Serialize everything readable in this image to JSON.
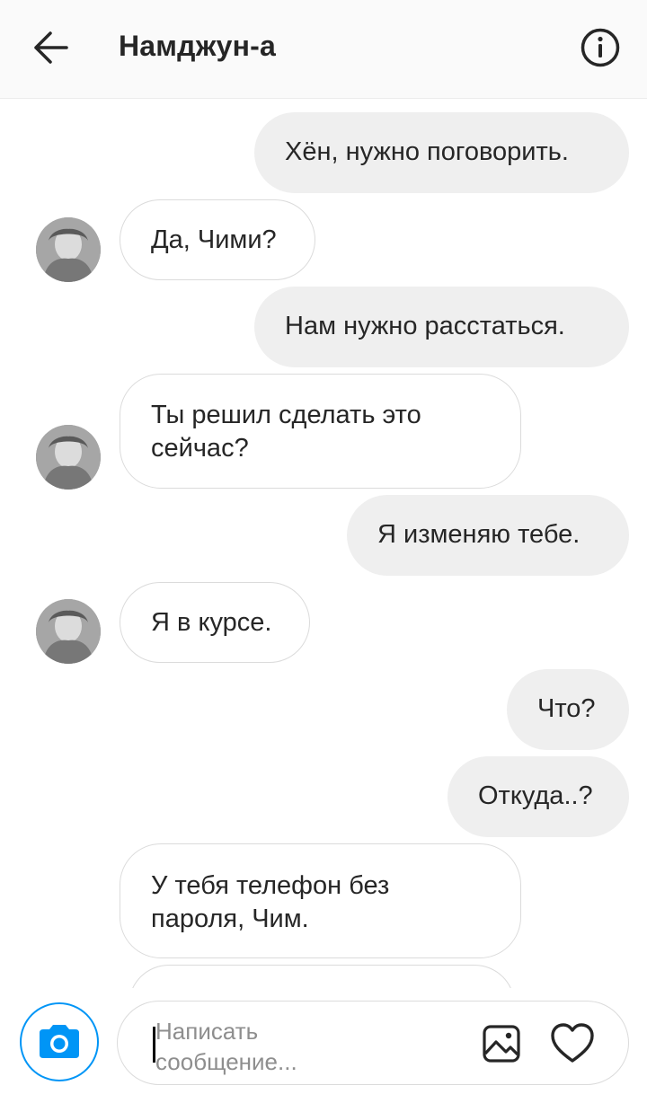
{
  "header": {
    "back_icon": "arrow-left-icon",
    "title": "Намджун-а",
    "info_icon": "info-circle-icon"
  },
  "messages": [
    {
      "direction": "out",
      "text": "Хён, нужно поговорить."
    },
    {
      "direction": "in",
      "text": "Да, Чими?"
    },
    {
      "direction": "out",
      "text": "Нам нужно расстаться."
    },
    {
      "direction": "in",
      "text_lines": [
        "Ты решил сделать это",
        "сейчас?"
      ]
    },
    {
      "direction": "out",
      "text": "Я изменяю тебе."
    },
    {
      "direction": "in",
      "text": "Я в курсе."
    },
    {
      "direction": "out",
      "text": "Что?"
    },
    {
      "direction": "out",
      "text": "Откуда..?"
    },
    {
      "direction": "in",
      "text_lines": [
        "У тебя телефон без",
        "пароля, Чим."
      ]
    }
  ],
  "composer": {
    "camera_icon": "camera-icon",
    "placeholder_lines": [
      "Написать",
      "сообщение..."
    ],
    "gallery_icon": "image-gallery-icon",
    "like_icon": "heart-icon",
    "accent_color": "#0095f6"
  }
}
